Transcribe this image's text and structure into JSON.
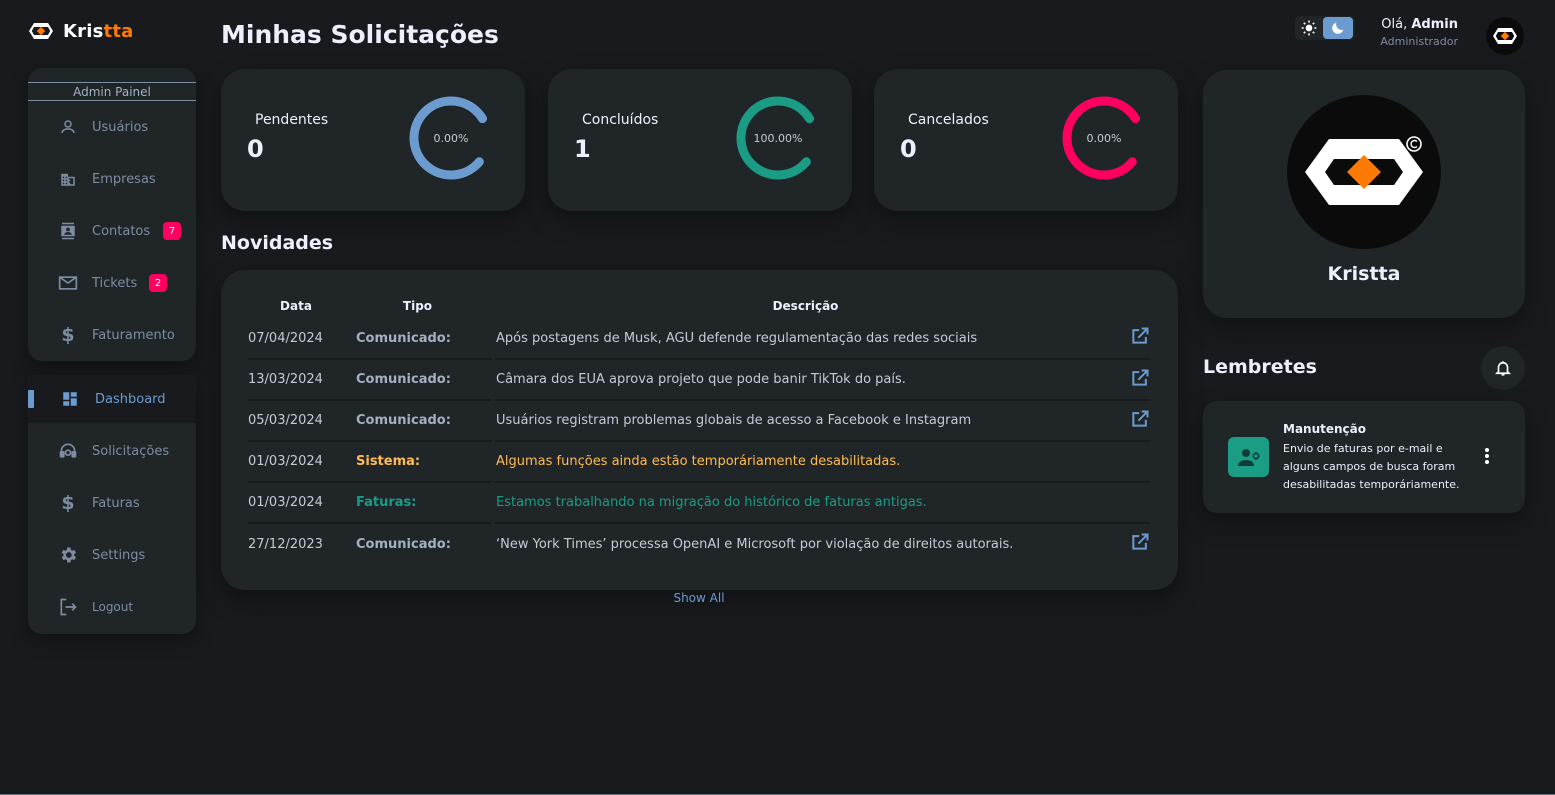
{
  "brand": {
    "name_part1": "Kris",
    "name_part2": "tta"
  },
  "header": {
    "title": "Minhas Solicitações",
    "greeting_prefix": "Olá, ",
    "user_name": "Admin",
    "user_role": "Administrador"
  },
  "sidebar": {
    "admin_title": "Admin Painel",
    "admin_items": [
      {
        "label": "Usuários",
        "icon": "person-icon"
      },
      {
        "label": "Empresas",
        "icon": "building-icon"
      },
      {
        "label": "Contatos",
        "icon": "contacts-icon",
        "badge": "7"
      },
      {
        "label": "Tickets",
        "icon": "mail-icon",
        "badge": "2"
      },
      {
        "label": "Faturamento",
        "icon": "dollar-icon"
      }
    ],
    "main_items": [
      {
        "label": "Dashboard",
        "icon": "dashboard-icon",
        "active": true
      },
      {
        "label": "Solicitações",
        "icon": "support-agent-icon"
      },
      {
        "label": "Faturas",
        "icon": "dollar-icon"
      },
      {
        "label": "Settings",
        "icon": "gear-icon"
      },
      {
        "label": "Logout",
        "icon": "logout-icon"
      }
    ]
  },
  "stats": [
    {
      "title": "Pendentes",
      "count": "0",
      "percent_label": "0.00%",
      "value": 0.0,
      "color": "#6c9bcf"
    },
    {
      "title": "Concluídos",
      "count": "1",
      "percent_label": "100.00%",
      "value": 100.0,
      "color": "#1b9c85"
    },
    {
      "title": "Cancelados",
      "count": "0",
      "percent_label": "0.00%",
      "value": 0.0,
      "color": "#ff0060"
    }
  ],
  "news": {
    "title": "Novidades",
    "columns": [
      "Data",
      "Tipo",
      "Descrição"
    ],
    "rows": [
      {
        "date": "07/04/2024",
        "type": "Comunicado:",
        "desc": "Após postagens de Musk, AGU defende regulamentação das redes sociais",
        "link": true,
        "tone": "default"
      },
      {
        "date": "13/03/2024",
        "type": "Comunicado:",
        "desc": "Câmara dos EUA aprova projeto que pode banir TikTok do país.",
        "link": true,
        "tone": "default"
      },
      {
        "date": "05/03/2024",
        "type": "Comunicado:",
        "desc": "Usuários registram problemas globais de acesso a Facebook e Instagram",
        "link": true,
        "tone": "default"
      },
      {
        "date": "01/03/2024",
        "type": "Sistema:",
        "desc": "Algumas funções ainda estão temporáriamente desabilitadas.",
        "link": false,
        "tone": "amber"
      },
      {
        "date": "01/03/2024",
        "type": "Faturas:",
        "desc": "Estamos trabalhando na migração do histórico de faturas antigas.",
        "link": false,
        "tone": "teal"
      },
      {
        "date": "27/12/2023",
        "type": "Comunicado:",
        "desc": "‘New York Times’ processa OpenAI e Microsoft por violação de direitos autorais.",
        "link": true,
        "tone": "default"
      }
    ],
    "show_all": "Show All"
  },
  "profile": {
    "name": "Kristta"
  },
  "reminders": {
    "title": "Lembretes",
    "items": [
      {
        "title": "Manutenção",
        "text": "Envio de faturas por e-mail e alguns campos de busca foram desabilitadas temporáriamente."
      }
    ]
  },
  "colors": {
    "background": "#181a1e",
    "card": "#202528",
    "primary": "#6c9bcf",
    "success": "#1b9c85",
    "danger": "#ff0060",
    "warning": "#ffbb55",
    "brand_orange": "#ff7a00"
  }
}
